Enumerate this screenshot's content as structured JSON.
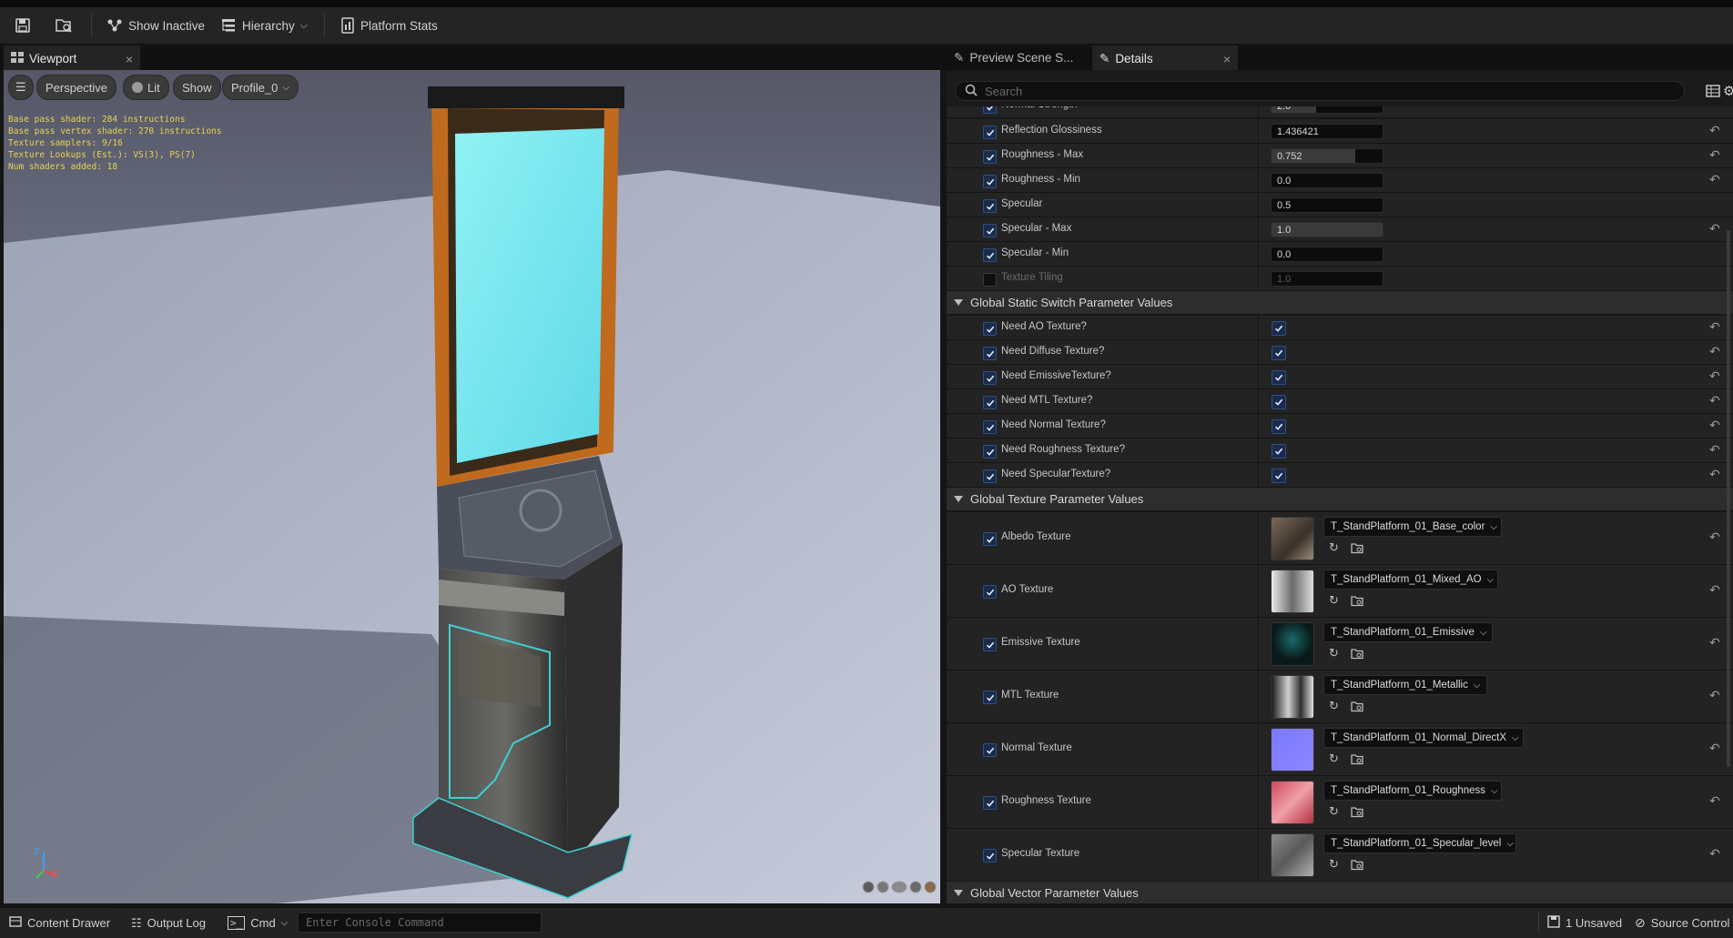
{
  "toolbar": {
    "save_icon": "save-icon",
    "browse_icon": "browse-icon",
    "show_inactive": "Show Inactive",
    "hierarchy": "Hierarchy",
    "platform_stats": "Platform Stats"
  },
  "viewport_tab": {
    "label": "Viewport",
    "close": "×"
  },
  "details_tabs": [
    {
      "label": "Preview Scene S..."
    },
    {
      "label": "Details",
      "close": "×"
    }
  ],
  "viewport": {
    "perspective": "Perspective",
    "lit": "Lit",
    "show": "Show",
    "profile": "Profile_0",
    "stats": [
      "Base pass shader: 284 instructions",
      "Base pass vertex shader: 270 instructions",
      "Texture samplers: 9/16",
      "Texture Lookups (Est.): VS(3), PS(7)",
      "Num shaders added: 18"
    ],
    "axis_z": "Z",
    "axis_x": "X"
  },
  "search": {
    "placeholder": "Search"
  },
  "scalar_params": [
    {
      "label": "Normal Strength",
      "value": "2.0",
      "checked": true,
      "slider": 0.4
    },
    {
      "label": "Reflection Glossiness",
      "value": "1.436421",
      "checked": true
    },
    {
      "label": "Roughness - Max",
      "value": "0.752",
      "checked": true,
      "slider": 0.75
    },
    {
      "label": "Roughness - Min",
      "value": "0.0",
      "checked": true
    },
    {
      "label": "Specular",
      "value": "0.5",
      "checked": true
    },
    {
      "label": "Specular  - Max",
      "value": "1.0",
      "checked": true,
      "slider": 1.0
    },
    {
      "label": "Specular - Min",
      "value": "0.0",
      "checked": true
    },
    {
      "label": "Texture Tiling",
      "value": "1.0",
      "checked": false
    }
  ],
  "static_switch": {
    "title": "Global Static Switch Parameter Values",
    "items": [
      "Need AO Texture?",
      "Need Diffuse Texture?",
      "Need EmissiveTexture?",
      "Need MTL Texture?",
      "Need Normal Texture?",
      "Need Roughness Texture?",
      "Need SpecularTexture?"
    ]
  },
  "texture_params": {
    "title": "Global Texture Parameter Values",
    "items": [
      {
        "label": "Albedo Texture",
        "asset": "T_StandPlatform_01_Base_color"
      },
      {
        "label": "AO Texture",
        "asset": "T_StandPlatform_01_Mixed_AO"
      },
      {
        "label": "Emissive Texture",
        "asset": "T_StandPlatform_01_Emissive"
      },
      {
        "label": "MTL Texture",
        "asset": "T_StandPlatform_01_Metallic"
      },
      {
        "label": "Normal Texture",
        "asset": "T_StandPlatform_01_Normal_DirectX"
      },
      {
        "label": "Roughness Texture",
        "asset": "T_StandPlatform_01_Roughness"
      },
      {
        "label": "Specular Texture",
        "asset": "T_StandPlatform_01_Specular_level"
      }
    ]
  },
  "vector_params": {
    "title": "Global Vector Parameter Values"
  },
  "bottombar": {
    "content_drawer": "Content Drawer",
    "output_log": "Output Log",
    "cmd": "Cmd",
    "console_placeholder": "Enter Console Command",
    "unsaved": "1 Unsaved",
    "source_control": "Source Control"
  },
  "colors": {
    "accent": "#2d4f88",
    "screen": "#7fe6ec",
    "frame": "#c06a1e",
    "trim": "#3fd0d0"
  }
}
